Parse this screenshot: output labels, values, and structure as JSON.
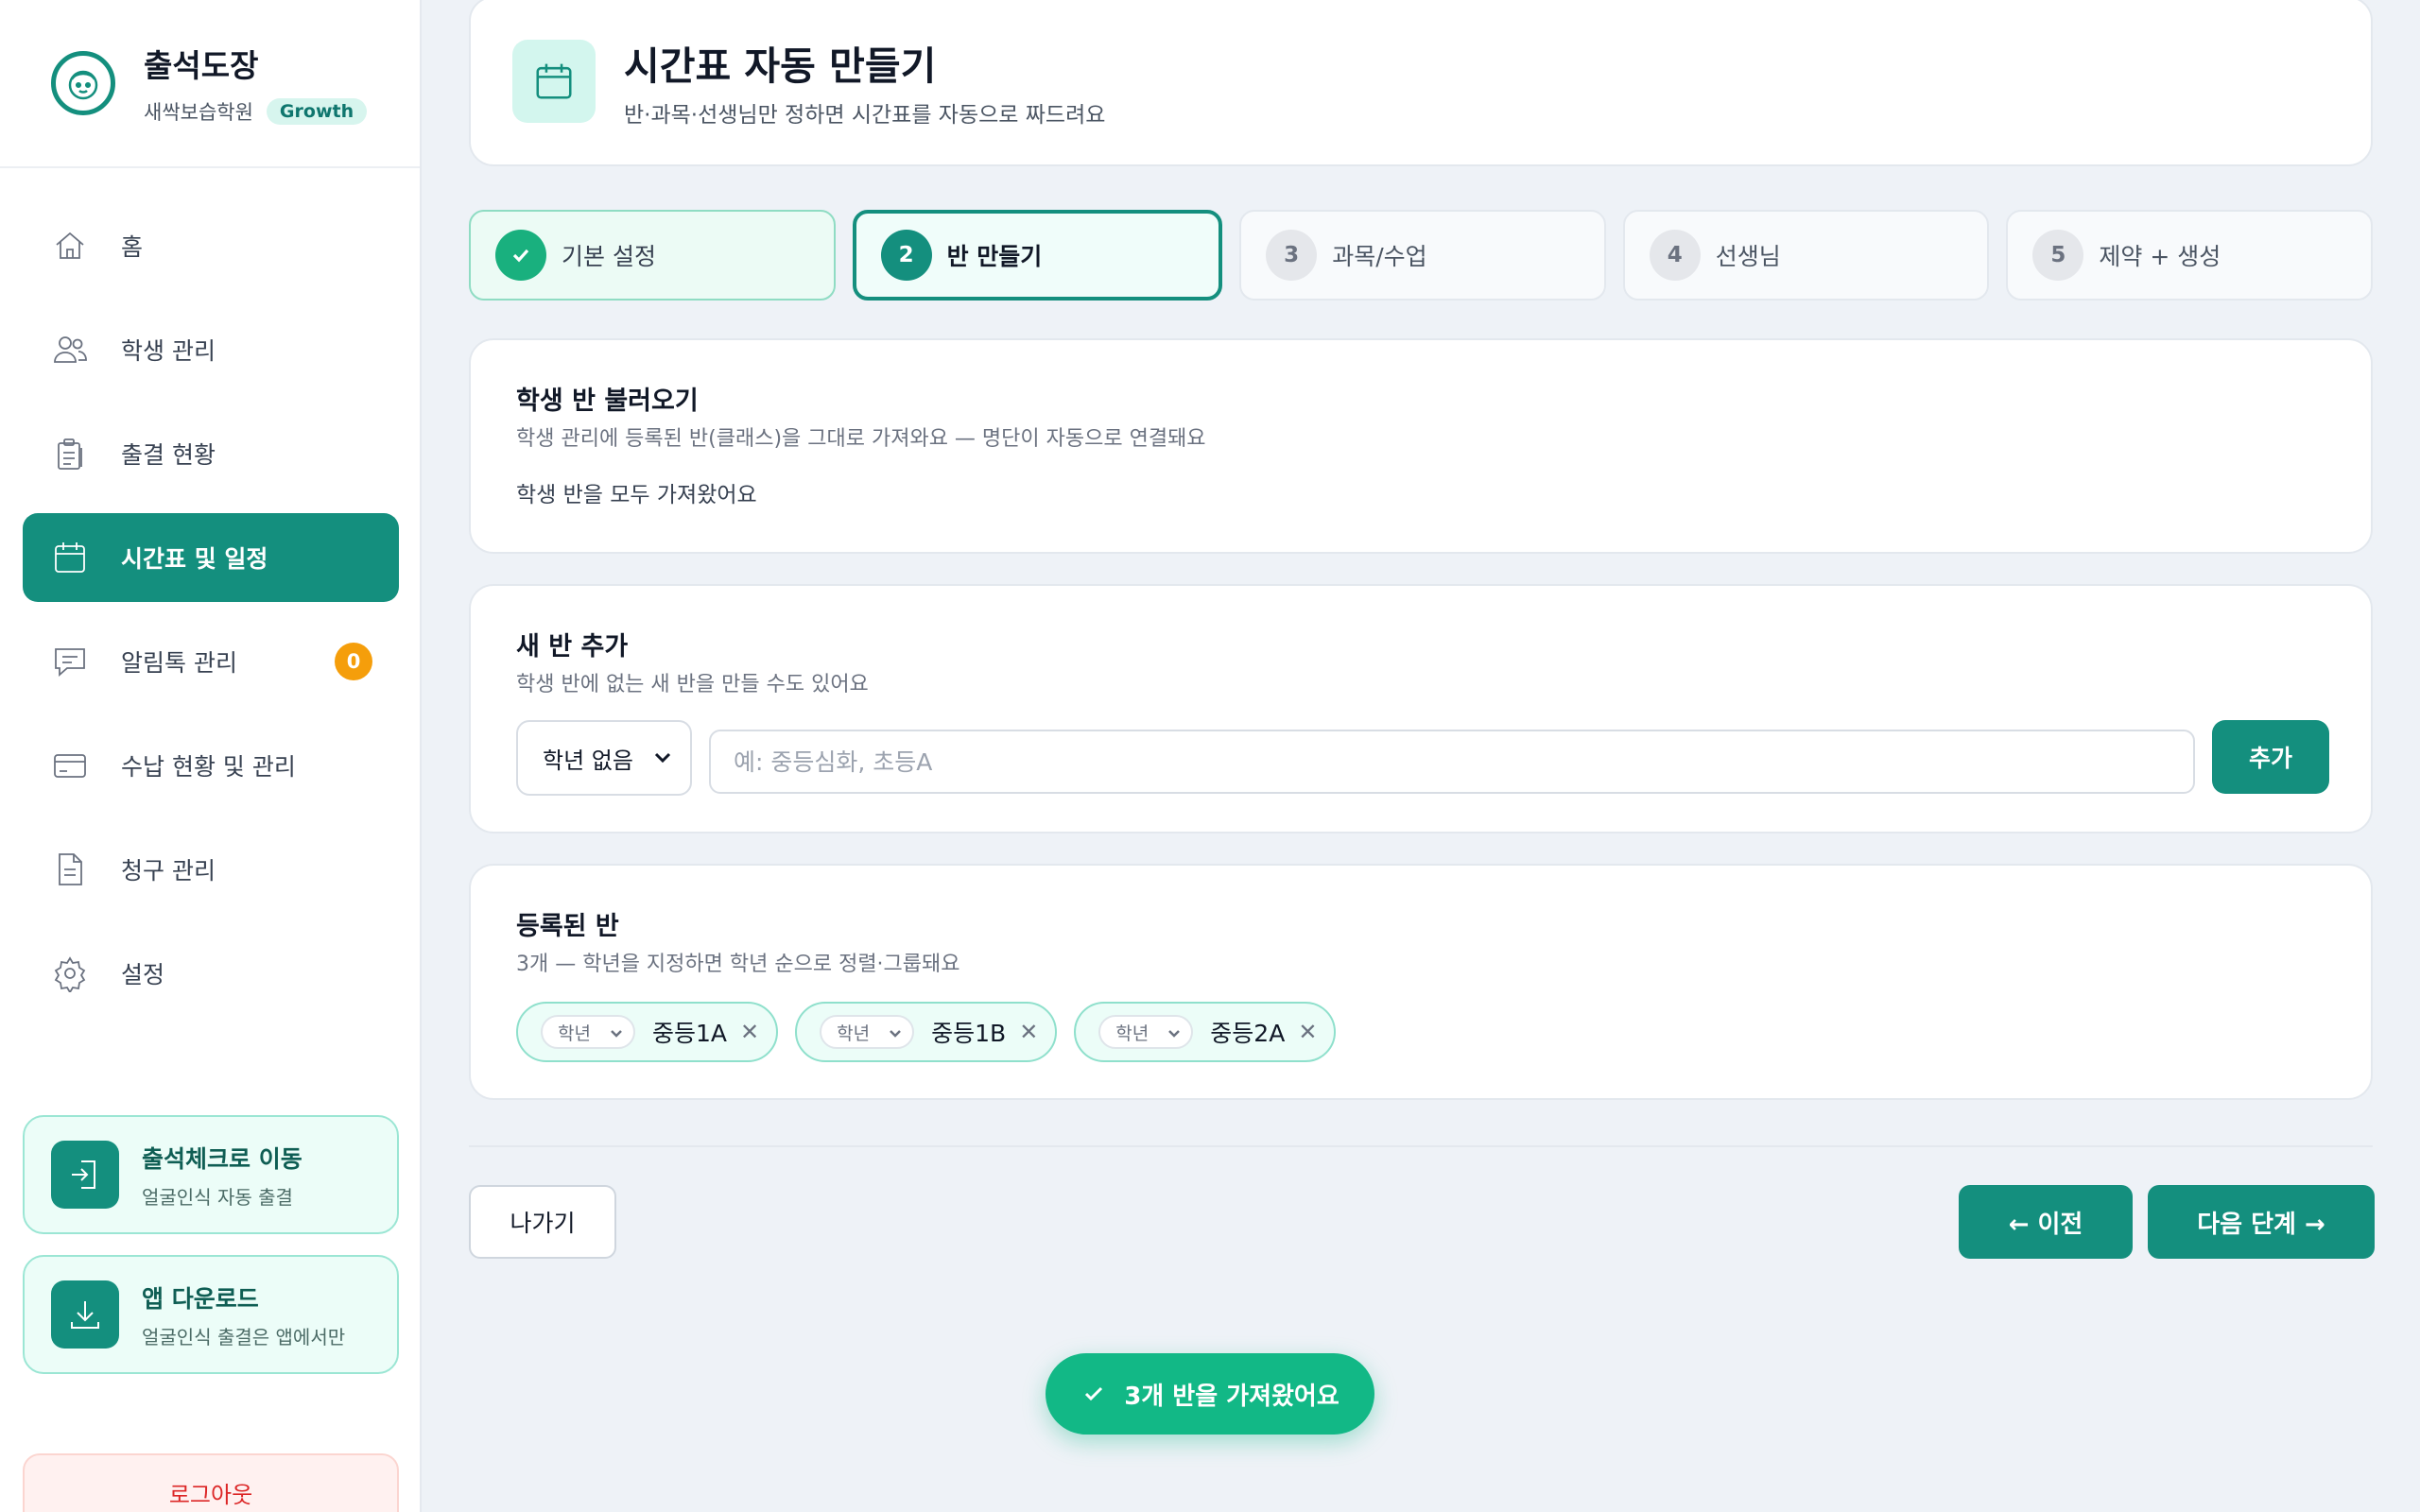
{
  "brand": {
    "name": "출석도장",
    "academy": "새싹보습학원",
    "plan": "Growth"
  },
  "nav": {
    "items": [
      {
        "label": "홈",
        "icon": "home-icon"
      },
      {
        "label": "학생 관리",
        "icon": "users-icon"
      },
      {
        "label": "출결 현황",
        "icon": "clipboard-icon"
      },
      {
        "label": "시간표 및 일정",
        "icon": "calendar-icon",
        "active": true
      },
      {
        "label": "알림톡 관리",
        "icon": "chat-icon",
        "badge": "0"
      },
      {
        "label": "수납 현황 및 관리",
        "icon": "card-icon"
      },
      {
        "label": "청구 관리",
        "icon": "document-icon"
      },
      {
        "label": "설정",
        "icon": "gear-icon"
      }
    ]
  },
  "side_cards": {
    "attendance": {
      "title": "출석체크로 이동",
      "subtitle": "얼굴인식 자동 출결"
    },
    "app": {
      "title": "앱 다운로드",
      "subtitle": "얼굴인식 출결은 앱에서만"
    }
  },
  "logout_label": "로그아웃",
  "header": {
    "title": "시간표 자동 만들기",
    "subtitle": "반·과목·선생님만 정하면 시간표를 자동으로 짜드려요"
  },
  "steps": [
    {
      "num": "1",
      "label": "기본 설정",
      "state": "done"
    },
    {
      "num": "2",
      "label": "반 만들기",
      "state": "current"
    },
    {
      "num": "3",
      "label": "과목/수업",
      "state": "pending"
    },
    {
      "num": "4",
      "label": "선생님",
      "state": "pending"
    },
    {
      "num": "5",
      "label": "제약 + 생성",
      "state": "pending"
    }
  ],
  "import_section": {
    "title": "학생 반 불러오기",
    "subtitle": "학생 관리에 등록된 반(클래스)을 그대로 가져와요 — 명단이 자동으로 연결돼요",
    "status": "학생 반을 모두 가져왔어요"
  },
  "add_section": {
    "title": "새 반 추가",
    "subtitle": "학생 반에 없는 새 반을 만들 수도 있어요",
    "grade_value": "학년 없음",
    "name_placeholder": "예: 중등심화, 초등A",
    "add_label": "추가"
  },
  "list_section": {
    "title": "등록된 반",
    "subtitle": "3개 — 학년을 지정하면 학년 순으로 정렬·그룹돼요",
    "classes": [
      {
        "grade": "학년",
        "name": "중등1A"
      },
      {
        "grade": "학년",
        "name": "중등1B"
      },
      {
        "grade": "학년",
        "name": "중등2A"
      }
    ]
  },
  "footer": {
    "exit_label": "나가기",
    "prev_label": "← 이전",
    "next_label": "다음 단계 →"
  },
  "toast": {
    "message": "3개 반을 가져왔어요"
  },
  "colors": {
    "accent": "#148f7e",
    "success": "#12b886",
    "badge": "#f59e0b",
    "background": "#eef2f7"
  }
}
